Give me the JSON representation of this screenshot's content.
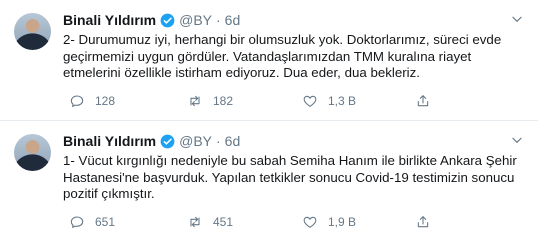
{
  "colors": {
    "accent": "#1da1f2",
    "muted": "#657786",
    "text": "#14171a",
    "divider": "#e6ecf0"
  },
  "tweets": [
    {
      "name": "Binali Yıldırım",
      "handle": "@BY",
      "separator": "·",
      "time": "6d",
      "text": "2- Durumumuz iyi, herhangi bir olumsuzluk yok. Doktorlarımız, süreci evde geçirmemizi uygun gördüler. Vatandaşlarımızdan TMM kuralına riayet etmelerini özellikle istirham ediyoruz. Dua eder, dua bekleriz.",
      "replies": "128",
      "retweets": "182",
      "likes": "1,3 B"
    },
    {
      "name": "Binali Yıldırım",
      "handle": "@BY",
      "separator": "·",
      "time": "6d",
      "text": "1- Vücut kırgınlığı nedeniyle bu sabah Semiha Hanım ile birlikte Ankara Şehir Hastanesi'ne başvurduk. Yapılan tetkikler sonucu Covid-19 testimizin sonucu pozitif çıkmıştır.",
      "replies": "651",
      "retweets": "451",
      "likes": "1,9 B"
    }
  ]
}
